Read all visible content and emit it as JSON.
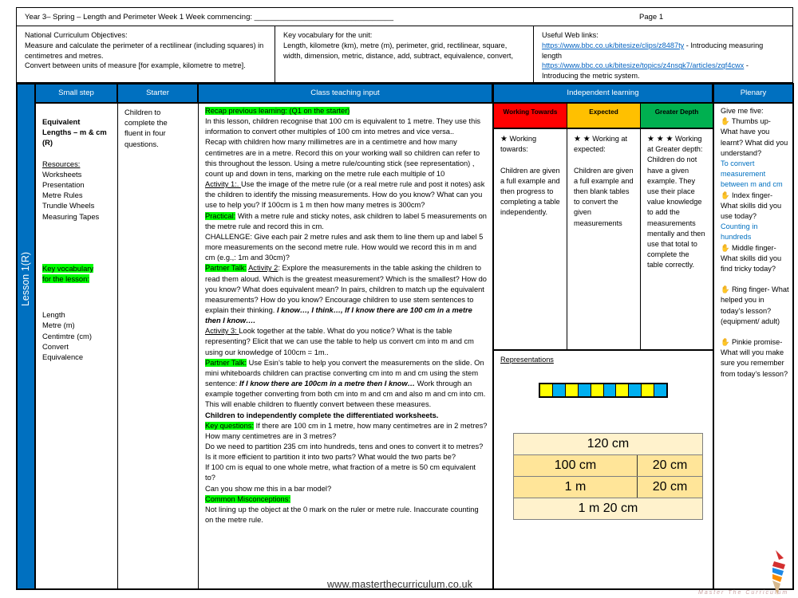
{
  "header": {
    "title": "Year 3– Spring – Length and Perimeter Week 1 Week commencing: _________________________________",
    "page": "Page 1"
  },
  "objectives": {
    "heading": "National Curriculum Objectives:",
    "lines": [
      "Measure and calculate the perimeter of a rectilinear (including squares) in centimetres and metres.",
      "Convert between units of measure [for example, kilometre to metre]."
    ]
  },
  "unit_vocab": {
    "heading": "Key vocabulary for the unit:",
    "text": "Length, kilometre (km), metre (m), perimeter, grid, rectilinear, square, width, dimension, metric, distance, add, subtract, equivalence, convert,"
  },
  "web_links": {
    "heading": "Useful Web links:",
    "links": [
      {
        "url": "https://www.bbc.co.uk/bitesize/clips/z8487ty",
        "desc": " - Introducing measuring length"
      },
      {
        "url": "https://www.bbc.co.uk/bitesize/topics/z4nsgk7/articles/zqf4cwx",
        "desc": " - Introducing the metric system."
      }
    ]
  },
  "columns": {
    "small_step": "Small step",
    "starter": "Starter",
    "class_teaching": "Class teaching input",
    "independent": "Independent learning",
    "plenary": "Plenary"
  },
  "lesson_label": "Lesson 1(R)",
  "small_step": {
    "title": "Equivalent Lengths – m & cm (R)",
    "resources_heading": "Resources:",
    "resources": [
      "Worksheets",
      "Presentation",
      "Metre Rules",
      "Trundle Wheels",
      "Measuring Tapes"
    ],
    "vocab_heading": "Key vocabulary for the lesson:",
    "vocab": [
      "Length",
      "Metre (m)",
      "Centimtre (cm)",
      "Convert",
      "Equivalence"
    ]
  },
  "starter": {
    "text": "Children to complete the fluent in four questions."
  },
  "teaching": {
    "recap_label": "Recap previous learning: (Q1 on the starter)",
    "p1": "In this lesson, children recognise that 100 cm is equivalent to 1 metre. They use this information to convert other multiples of 100 cm into metres and vice versa..",
    "p2": "Recap with children how many millimetres are in a centimetre and how many centimetres are in a metre.  Record this on your working wall so children can refer to this throughout the lesson. Using a metre rule/counting stick (see representation) , count up and down in tens, marking on the metre rule each multiple of 10",
    "act1_label": "Activity 1:. ",
    "act1_text": " Use the image of the metre rule (or a real metre rule and post it notes) ask the children to identify the missing measurements.  How do you know?  What can you use to help you?  If 100cm is 1 m then how many metres is 300cm?",
    "practical_label": "Practical:",
    "practical_text": " With a metre rule and sticky notes, ask children to label 5 measurements on the metre rule and record this in cm.",
    "challenge": "CHALLENGE:  Give each pair 2 metre rules and ask them to line them up and label 5 more measurements on the second metre rule.  How would we record this in m and cm (e.g.,: 1m and 30cm)?",
    "partner_label": "Partner Talk:",
    "act2_label": "Activity 2",
    "act2_text": ":  Explore the measurements in the table asking the children to read them aloud.  Which is the greatest measurement? Which is the smallest? How do you know?  What does equivalent mean?  In pairs, children to match up the equivalent  measurements?  How do you know? Encourage children to use stem sentences to explain their thinking. ",
    "stem1": "I know…, I think…,  If I know there are 100 cm in a metre then I know….",
    "act3_label": "Activity 3: ",
    "act3_text": " Look together at the table.  What do you notice?  What is the table representing?  Elicit that we can use the table to help us convert cm into m and cm using our knowledge of 100cm = 1m..",
    "partner2_label": "Partner Talk:",
    "partner2_text": " Use Esin’s table to help you convert the measurements on the slide. On  mini whiteboards children can practise converting cm into m and cm using the stem sentence: ",
    "stem2": "If I know there are 100cm in a metre then I know…",
    "partner2_tail": "  Work through an example together converting from both cm into m and cm and also m and cm into cm.  This will enable children to fluently convert between these measures.",
    "independent_bold": "Children to independently complete the differentiated worksheets.",
    "keyq_label": "Key questions:",
    "keyq1": " If there are 100 cm in 1 metre, how many centimetres are in 2 metres? How many centimetres are in 3 metres?",
    "keyq2": "Do we need to partition 235 cm into hundreds, tens and ones to convert it to metres? Is it more efficient to partition it into two parts? What would the two parts be?",
    "keyq3": "If 100 cm is equal to one whole metre, what fraction of a metre is 50 cm equivalent to?",
    "keyq4": "Can you show me this in a bar model?",
    "misc_label": "Common Misconceptions:",
    "misc_text": "Not lining up the object at the 0 mark on the ruler or metre rule. Inaccurate counting on the metre rule."
  },
  "levels": [
    {
      "name": "Working Towards",
      "color": "#ff0000",
      "stars": "★",
      "sub": " Working towards:",
      "text": "Children are given a full example and then progress to completing a table independently."
    },
    {
      "name": "Expected",
      "color": "#ffc000",
      "stars": "★ ★",
      "sub": " Working at expected:",
      "text": "Children are given a full example and then blank tables to convert the given measurements"
    },
    {
      "name": "Greater Depth",
      "color": "#00b050",
      "stars": "★ ★ ★",
      "sub": "Working at Greater depth:",
      "text": "Children do not have a given example. They use their place value knowledge to add the measurements mentally and then use that total to complete the table correctly."
    }
  ],
  "representations": {
    "title": "Representations",
    "bar_colors": [
      "#ffff00",
      "#00b0f0",
      "#ffff00",
      "#00b0f0",
      "#ffff00",
      "#00b0f0",
      "#ffff00",
      "#00b0f0",
      "#ffff00",
      "#00b0f0"
    ],
    "table": {
      "row1": "120 cm",
      "row2": [
        "100 cm",
        "20 cm"
      ],
      "row3": [
        "1 m",
        "20 cm"
      ],
      "row4": "1 m 20 cm"
    }
  },
  "plenary": {
    "intro": "Give me five:",
    "items": [
      {
        "prompt": " Thumbs up- What have you learnt? What did you understand?",
        "answer": "To convert measurement between m and cm"
      },
      {
        "prompt": " Index finger- What skills did you use today?",
        "answer": "Counting in hundreds"
      },
      {
        "prompt": " Middle finger- What skills did you find tricky today?",
        "answer": ""
      },
      {
        "prompt": " Ring finger- What helped you in today’s lesson? (equipment/ adult)",
        "answer": ""
      },
      {
        "prompt": " Pinkie promise- What will you make sure you remember from today’s lesson?",
        "answer": ""
      }
    ]
  },
  "footer": {
    "url": "www.masterthecurriculum.co.uk",
    "logo_text": "Master The Curriculum"
  }
}
